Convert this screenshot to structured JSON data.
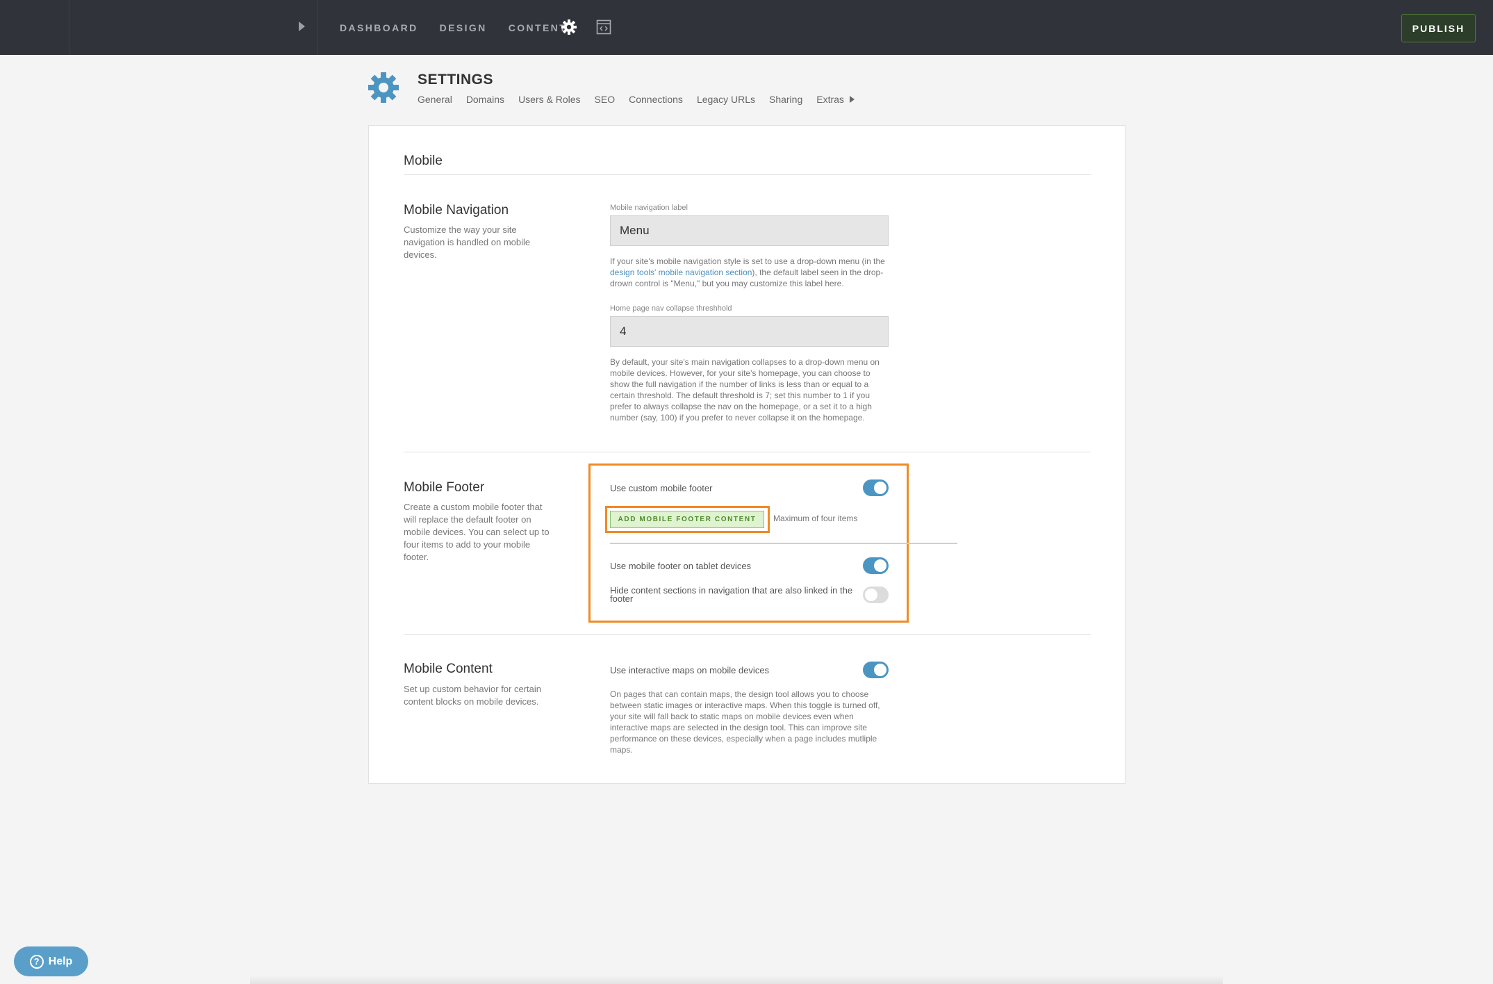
{
  "topbar": {
    "nav": [
      "DASHBOARD",
      "DESIGN",
      "CONTENT"
    ],
    "publish_label": "PUBLISH"
  },
  "settings": {
    "title": "SETTINGS",
    "tabs": [
      "General",
      "Domains",
      "Users & Roles",
      "SEO",
      "Connections",
      "Legacy URLs",
      "Sharing",
      "Extras"
    ]
  },
  "panel": {
    "title": "Mobile",
    "mobile_navigation": {
      "heading": "Mobile Navigation",
      "description": "Customize the way your site navigation is handled on mobile devices.",
      "label_field_label": "Mobile navigation label",
      "label_field_value": "Menu",
      "label_help_before": "If your site's mobile navigation style is set to use a drop-down menu (in the ",
      "label_help_link": "design tools' mobile navigation section",
      "label_help_after": "), the default label seen in the drop-drown control is \"Menu,\" but you may customize this label here.",
      "threshold_label": "Home page nav collapse threshhold",
      "threshold_value": "4",
      "threshold_help": "By default, your site's main navigation collapses to a drop-down menu on mobile devices. However, for your site's homepage, you can choose to show the full navigation if the number of links is less than or equal to a certain threshold. The default threshold is 7; set this number to 1 if you prefer to always collapse the nav on the homepage, or a set it to a high number (say, 100) if you prefer to never collapse it on the homepage."
    },
    "mobile_footer": {
      "heading": "Mobile Footer",
      "description": "Create a custom mobile footer that will replace the default footer on mobile devices. You can select up to four items to add to your mobile footer.",
      "custom_footer_label": "Use custom mobile footer",
      "custom_footer_on": true,
      "add_button_label": "ADD MOBILE FOOTER CONTENT",
      "max_items_text": "Maximum of four items",
      "tablet_label": "Use mobile footer on tablet devices",
      "tablet_on": true,
      "hide_sections_label": "Hide content sections in navigation that are also linked in the footer",
      "hide_sections_on": false
    },
    "mobile_content": {
      "heading": "Mobile Content",
      "description": "Set up custom behavior for certain content blocks on mobile devices.",
      "maps_label": "Use interactive maps on mobile devices",
      "maps_on": true,
      "maps_help": "On pages that can contain maps, the design tool allows you to choose between static images or interactive maps. When this toggle is turned off, your site will fall back to static maps on mobile devices even when interactive maps are selected in the design tool. This can improve site performance on these devices, especially when a page includes mutliple maps."
    }
  },
  "help_button_label": "Help",
  "colors": {
    "topbar": "#30343a",
    "accent_blue": "#4b95c2",
    "highlight_orange": "#f08a24",
    "add_button_green": "#dff3d0"
  }
}
